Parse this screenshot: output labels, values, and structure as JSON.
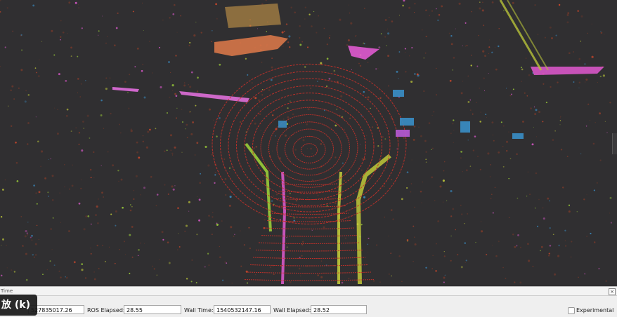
{
  "viewport": {
    "label": "3D lidar point cloud view",
    "background": "#302f31",
    "ring_color": "#c8312a",
    "point_colors": [
      "#e05ad0",
      "#a9e23a",
      "#e04b2a",
      "#c8d23a",
      "#3a8fc8"
    ]
  },
  "time_panel": {
    "title": "Time",
    "close_icon": "close-icon",
    "ros_time_value": "527835017.26",
    "ros_elapsed_label": "ROS Elapsed:",
    "ros_elapsed_value": "28.55",
    "wall_time_label": "Wall Time:",
    "wall_time_value": "1540532147.16",
    "wall_elapsed_label": "Wall Elapsed:",
    "wall_elapsed_value": "28.52",
    "experimental_label": "Experimental",
    "experimental_checked": false
  },
  "tooltip": {
    "text": "放 (k)"
  }
}
